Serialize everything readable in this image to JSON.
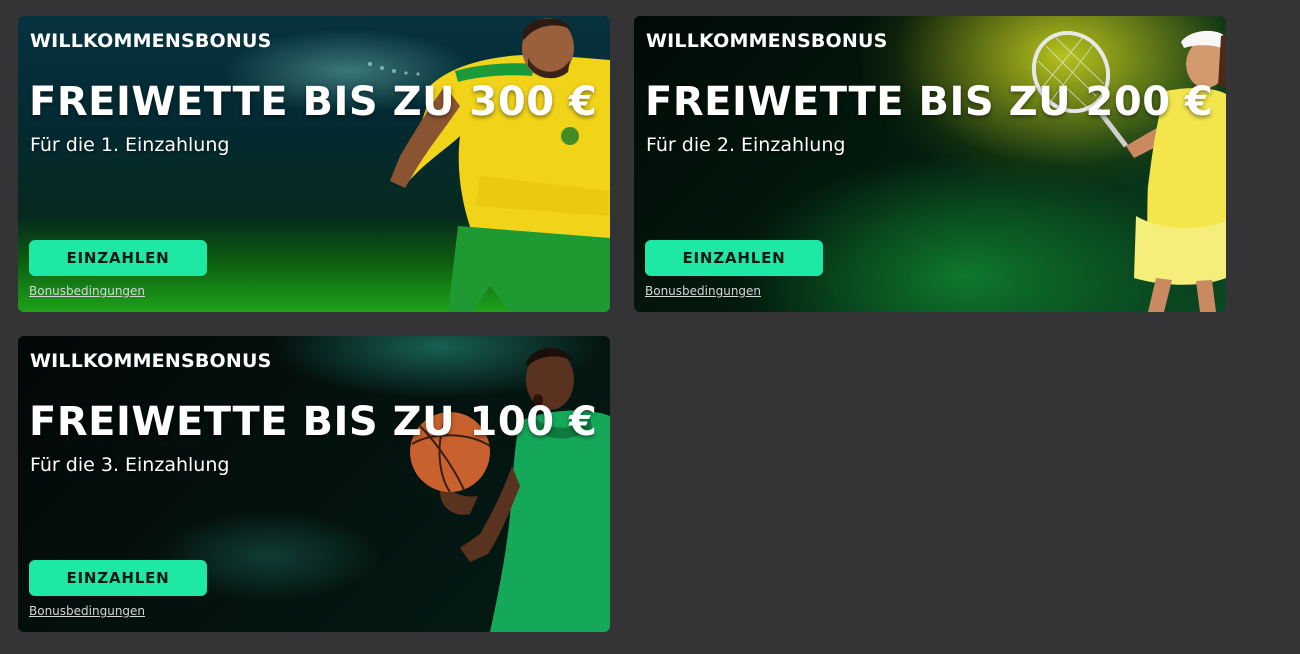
{
  "offers": [
    {
      "eyebrow": "WILLKOMMENSBONUS",
      "headline": "FREIWETTE BIS ZU 300 €",
      "subline": "Für die 1. Einzahlung",
      "cta_label": "EINZAHLEN",
      "terms_label": "Bonusbedingungen",
      "image_subject": "football-player-illustration"
    },
    {
      "eyebrow": "WILLKOMMENSBONUS",
      "headline": "FREIWETTE BIS ZU 200 €",
      "subline": "Für die 2. Einzahlung",
      "cta_label": "EINZAHLEN",
      "terms_label": "Bonusbedingungen",
      "image_subject": "tennis-player-illustration"
    },
    {
      "eyebrow": "WILLKOMMENSBONUS",
      "headline": "FREIWETTE BIS ZU 100 €",
      "subline": "Für die 3. Einzahlung",
      "cta_label": "EINZAHLEN",
      "terms_label": "Bonusbedingungen",
      "image_subject": "basketball-player-illustration"
    }
  ],
  "colors": {
    "page_background": "#343437",
    "cta_background": "#1de9a4",
    "cta_text": "#0b1a14",
    "text": "#ffffff"
  }
}
